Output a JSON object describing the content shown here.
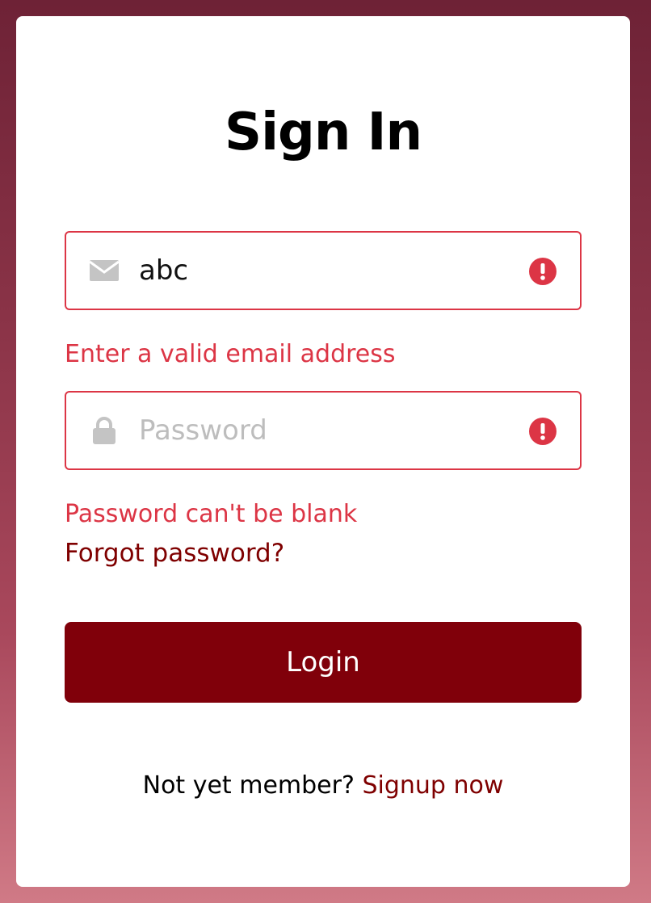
{
  "title": "Sign In",
  "email": {
    "value": "abc",
    "error": "Enter a valid email address",
    "icon": "envelope-icon"
  },
  "password": {
    "placeholder": "Password",
    "error": "Password can't be blank",
    "icon": "lock-icon"
  },
  "forgot_link": "Forgot password?",
  "login_label": "Login",
  "footer": {
    "prompt": "Not yet member?",
    "signup_link": "Signup now"
  },
  "colors": {
    "accent": "#80000a",
    "error": "#dc3545",
    "placeholder": "#bdbdbd"
  }
}
